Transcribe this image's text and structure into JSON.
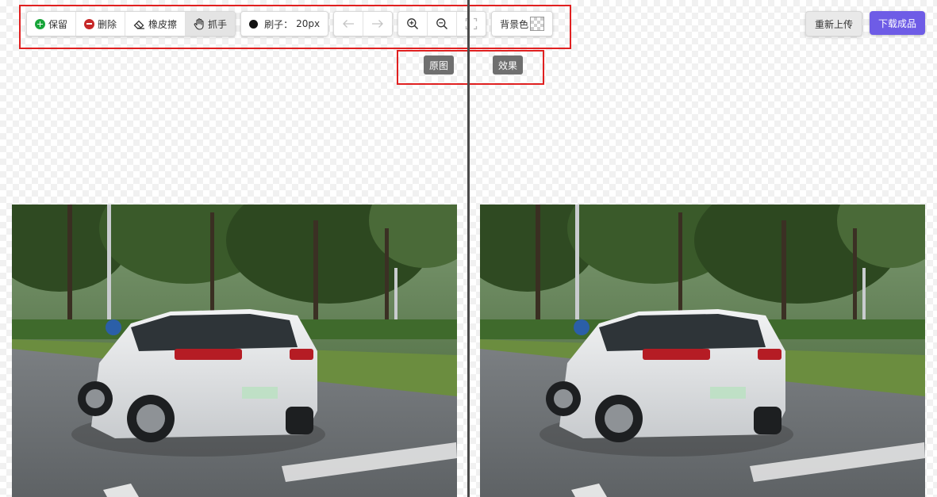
{
  "toolbar": {
    "keep": {
      "label": "保留",
      "icon": "plus-circle-icon",
      "color": "#18a53a"
    },
    "delete": {
      "label": "删除",
      "icon": "minus-circle-icon",
      "color": "#c62828"
    },
    "eraser": {
      "label": "橡皮擦",
      "icon": "eraser-icon"
    },
    "hand": {
      "label": "抓手",
      "icon": "hand-icon",
      "active": true
    },
    "brush": {
      "label": "刷子：",
      "value": "20px"
    },
    "undo": {
      "icon": "arrow-left-icon",
      "disabled": true
    },
    "redo": {
      "icon": "arrow-right-icon",
      "disabled": true
    },
    "zoom_in": {
      "icon": "zoom-in-icon"
    },
    "zoom_out": {
      "icon": "zoom-out-icon"
    },
    "fit": {
      "icon": "fullscreen-icon",
      "disabled": true
    },
    "background": {
      "label": "背景色",
      "icon": "transparent-swatch-icon"
    }
  },
  "actions": {
    "reupload": "重新上传",
    "download": "下载成品",
    "download_color": "#6e5ce6"
  },
  "labels": {
    "original": "原图",
    "result": "效果"
  },
  "colors": {
    "highlight": "#e02020",
    "divider": "#4a4a4a",
    "tag_background": "#6f6f6f"
  }
}
